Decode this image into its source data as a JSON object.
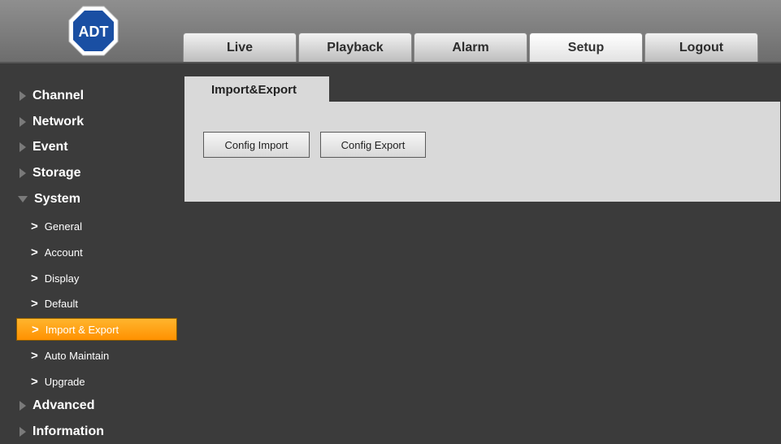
{
  "brand": {
    "logo_text": "ADT",
    "logo_color": "#1a4fa3"
  },
  "nav": {
    "tabs": [
      {
        "label": "Live"
      },
      {
        "label": "Playback"
      },
      {
        "label": "Alarm"
      },
      {
        "label": "Setup",
        "active": true
      },
      {
        "label": "Logout"
      }
    ]
  },
  "sidebar": {
    "categories": {
      "channel": "Channel",
      "network": "Network",
      "event": "Event",
      "storage": "Storage",
      "system": "System",
      "advanced": "Advanced",
      "information": "Information"
    },
    "system_items": [
      {
        "label": "General"
      },
      {
        "label": "Account"
      },
      {
        "label": "Display"
      },
      {
        "label": "Default"
      },
      {
        "label": "Import & Export",
        "active": true
      },
      {
        "label": "Auto Maintain"
      },
      {
        "label": "Upgrade"
      }
    ],
    "active_color": "#ff9f10"
  },
  "panel": {
    "tab_label": "Import&Export",
    "config_import_label": "Config Import",
    "config_export_label": "Config Export"
  }
}
